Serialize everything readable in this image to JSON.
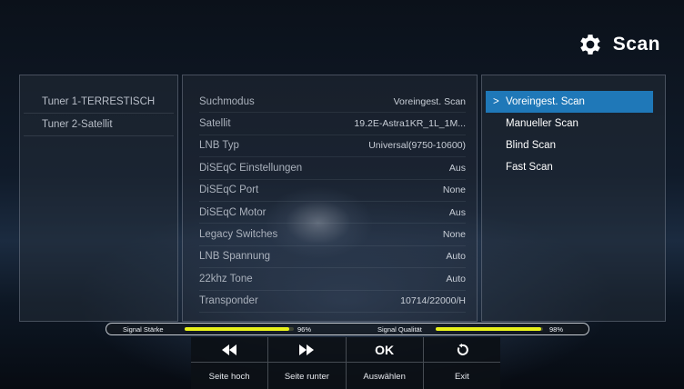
{
  "header": {
    "title": "Scan",
    "icon": "gear-icon"
  },
  "tuners": [
    "Tuner 1-TERRESTISCH",
    "Tuner 2-Satellit"
  ],
  "params": [
    {
      "label": "Suchmodus",
      "value": "Voreingest. Scan"
    },
    {
      "label": "Satellit",
      "value": "19.2E-Astra1KR_1L_1M..."
    },
    {
      "label": "LNB Typ",
      "value": "Universal(9750-10600)"
    },
    {
      "label": "DiSEqC Einstellungen",
      "value": "Aus"
    },
    {
      "label": "DiSEqC Port",
      "value": "None"
    },
    {
      "label": "DiSEqC Motor",
      "value": "Aus"
    },
    {
      "label": "Legacy Switches",
      "value": "None"
    },
    {
      "label": "LNB Spannung",
      "value": "Auto"
    },
    {
      "label": "22khz Tone",
      "value": "Auto"
    },
    {
      "label": "Transponder",
      "value": "10714/22000/H"
    }
  ],
  "scan_modes": {
    "selected_index": 0,
    "items": [
      "Voreingest. Scan",
      "Manueller Scan",
      "Blind Scan",
      "Fast Scan"
    ],
    "chevron": ">"
  },
  "signal": {
    "strength_label": "Signal Stärke",
    "strength_value": 96,
    "strength_text": "96%",
    "quality_label": "Signal Qualität",
    "quality_value": 98,
    "quality_text": "98%",
    "fill_color": "#e9f21a"
  },
  "buttons": [
    {
      "icon": "rewind-icon",
      "glyph": "◀◀",
      "label": "Seite hoch"
    },
    {
      "icon": "fast-forward-icon",
      "glyph": "▶▶",
      "label": "Seite runter"
    },
    {
      "icon": "ok-icon",
      "glyph": "OK",
      "label": "Auswählen"
    },
    {
      "icon": "exit-icon",
      "glyph": "",
      "label": "Exit"
    }
  ]
}
